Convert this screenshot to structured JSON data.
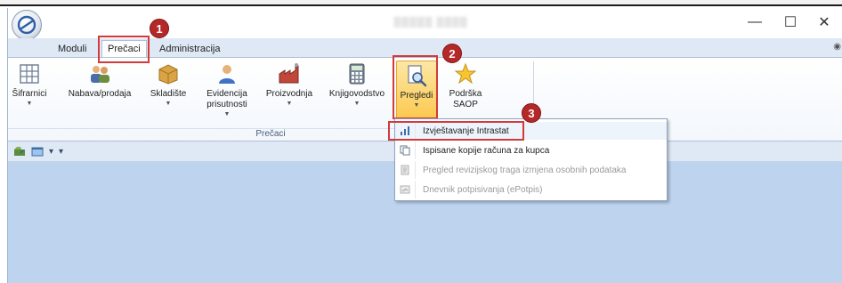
{
  "title": {
    "app_title": "▒▒▒▒▒ ▒▒▒▒"
  },
  "window_controls": {
    "minimize": "—",
    "maximize": "☐",
    "close": "✕"
  },
  "tabs": [
    {
      "label": "Moduli",
      "active": false
    },
    {
      "label": "Prečaci",
      "active": true
    },
    {
      "label": "Administracija",
      "active": false
    }
  ],
  "ribbon": {
    "group_label": "Prečaci",
    "buttons": [
      {
        "label": "Šifrarnici",
        "icon": "grid-icon"
      },
      {
        "label": "Nabava/prodaja",
        "icon": "people-icon"
      },
      {
        "label": "Skladište",
        "icon": "box-icon"
      },
      {
        "label": "Evidencija prisutnosti",
        "icon": "person-icon"
      },
      {
        "label": "Proizvodnja",
        "icon": "factory-icon"
      },
      {
        "label": "Knjigovodstvo",
        "icon": "calculator-icon"
      },
      {
        "label": "Pregledi",
        "icon": "magnifier-document-icon"
      },
      {
        "label": "Podrška SAOP",
        "icon": "star-icon"
      }
    ]
  },
  "dropdown": {
    "items": [
      {
        "label": "Izvještavanje Intrastat",
        "icon": "bar-chart-icon",
        "enabled": true
      },
      {
        "label": "Ispisane kopije računa za kupca",
        "icon": "copy-icon",
        "enabled": true
      },
      {
        "label": "Pregled revizijskog traga izmjena osobnih podataka",
        "icon": "audit-icon",
        "enabled": false
      },
      {
        "label": "Dnevnik potpisivanja (ePotpis)",
        "icon": "signature-icon",
        "enabled": false
      }
    ]
  },
  "annotations": {
    "badge1": "1",
    "badge2": "2",
    "badge3": "3"
  },
  "colors": {
    "highlight_red": "#d43a3a",
    "badge_red": "#b52828",
    "selected_button": "#fbc74a",
    "workspace": "#bdd3ee"
  }
}
